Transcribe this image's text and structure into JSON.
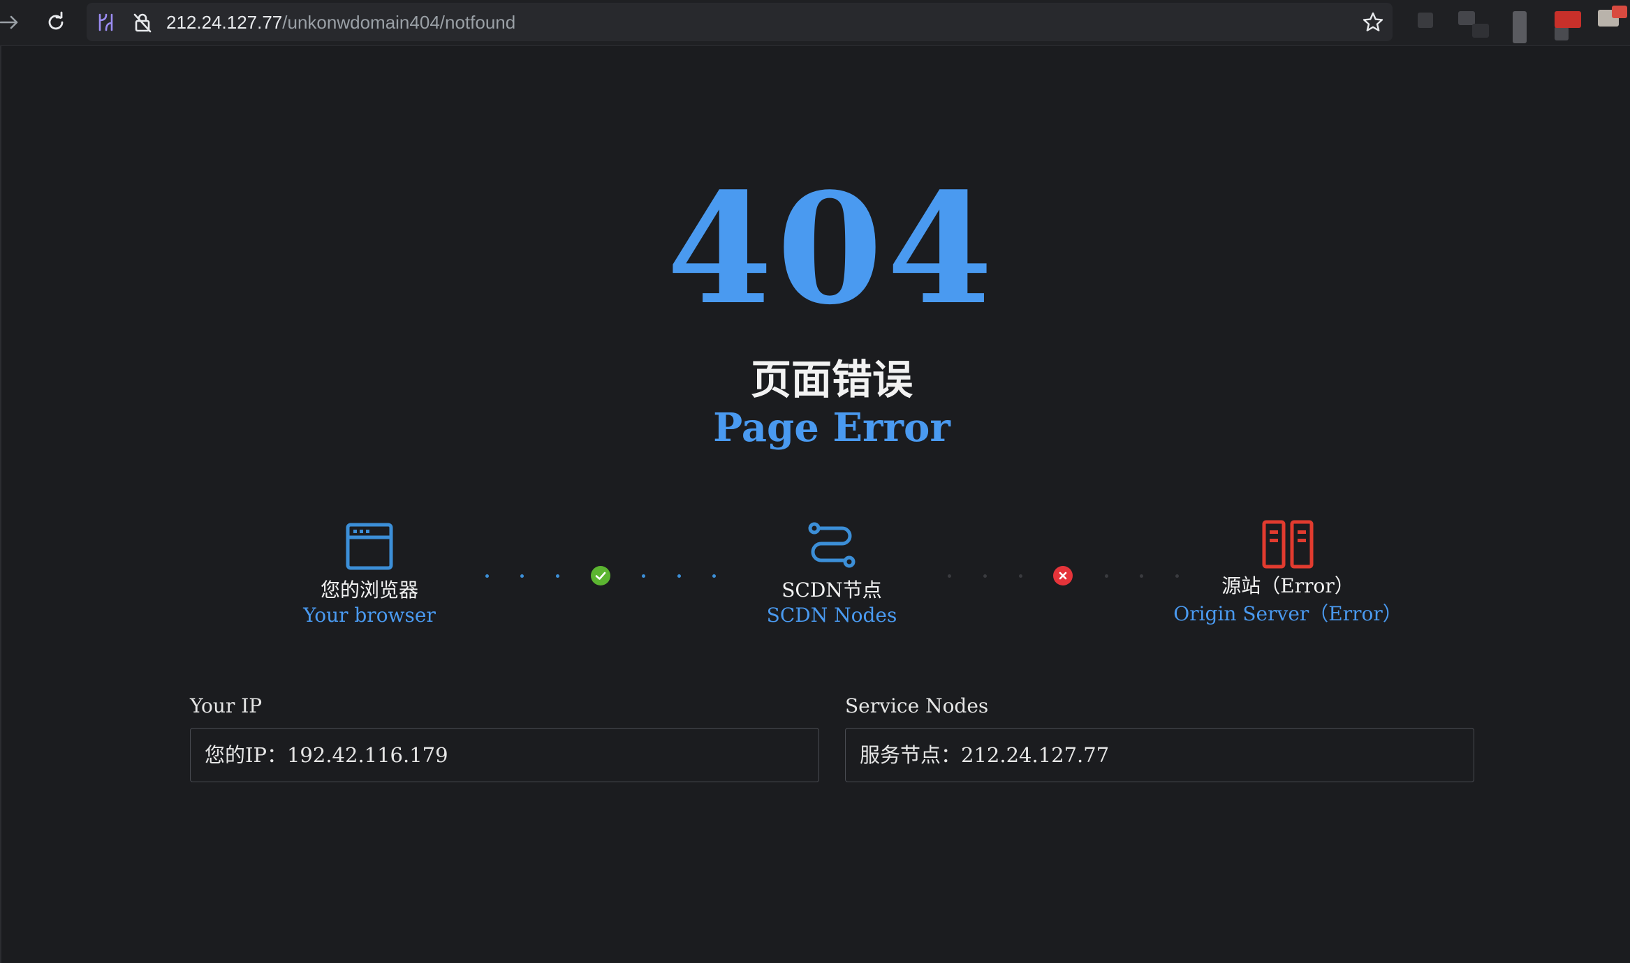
{
  "browser": {
    "url_host": "212.24.127.77",
    "url_path": "/unkonwdomain404/notfound",
    "icons": [
      "forward-icon",
      "reload-icon",
      "tab-search-icon",
      "not-secure-icon",
      "bookmark-star-icon"
    ]
  },
  "error": {
    "code": "404",
    "title_cn": "页面错误",
    "title_en": "Page Error"
  },
  "flow": {
    "browser": {
      "label_cn": "您的浏览器",
      "label_en": "Your browser",
      "icon": "browser-window-icon",
      "color": "#3c8fd8"
    },
    "cdn": {
      "label_cn": "SCDN节点",
      "label_en": "SCDN Nodes",
      "icon": "route-icon",
      "color": "#3c8fd8"
    },
    "origin": {
      "label_cn": "源站（Error）",
      "label_en": "Origin Server（Error）",
      "icon": "server-icon",
      "color": "#e23b2f"
    },
    "link1_status": "ok",
    "link2_status": "error",
    "ok_color": "#5cb531",
    "error_color": "#e5343a"
  },
  "info": {
    "ip_label": "Your IP",
    "ip_value": "您的IP：192.42.116.179",
    "nodes_label": "Service Nodes",
    "nodes_value": "服务节点：212.24.127.77"
  }
}
